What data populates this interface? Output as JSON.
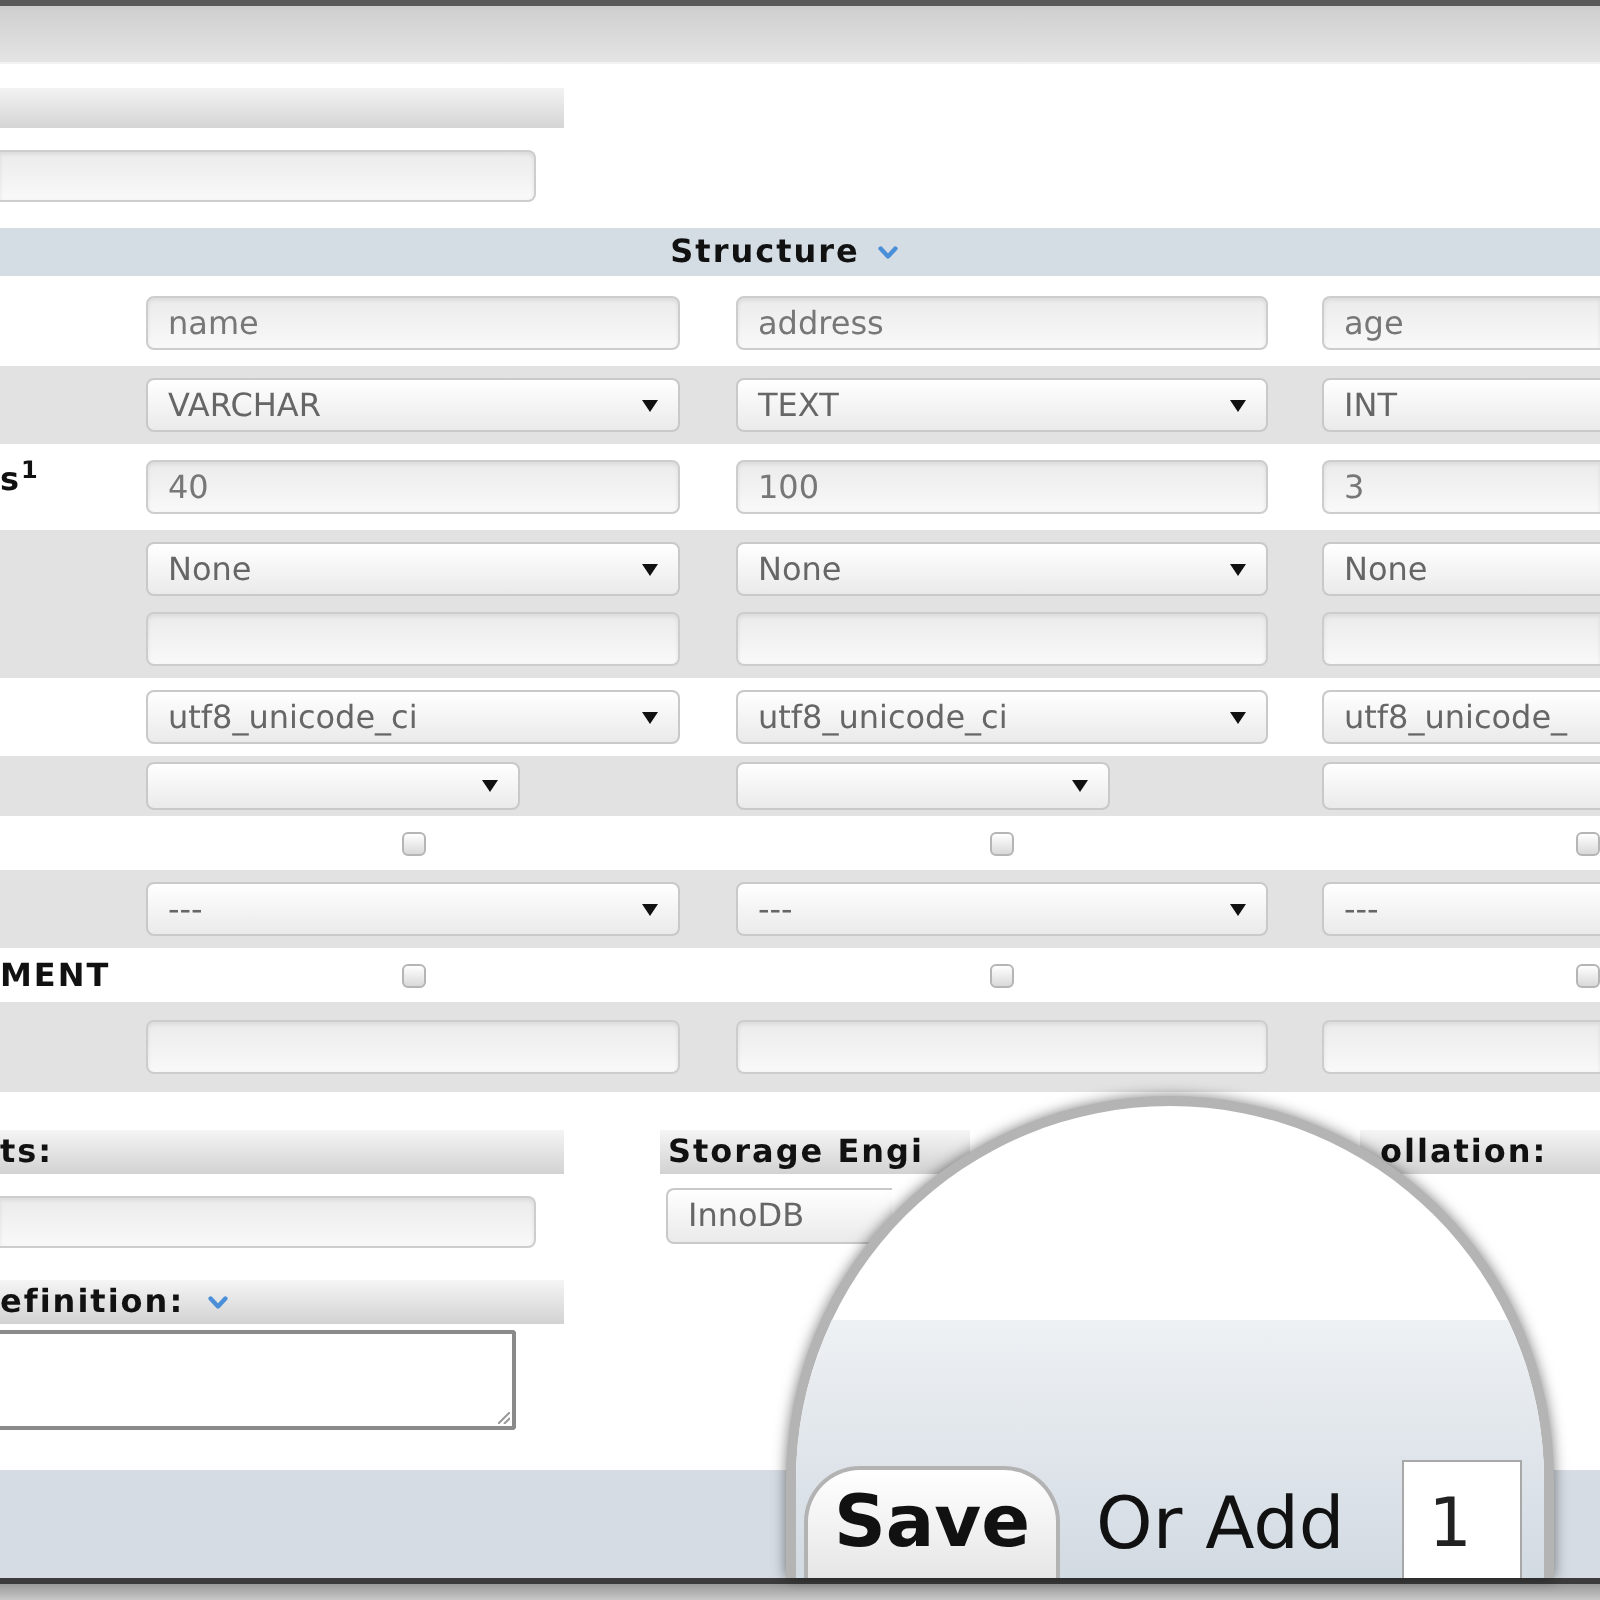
{
  "structure": {
    "title": "Structure",
    "collapsible": true,
    "rows": [
      {
        "cells": [
          {
            "kind": "input",
            "value": "name"
          },
          {
            "kind": "input",
            "value": "address"
          },
          {
            "kind": "input",
            "value": "age"
          }
        ]
      },
      {
        "cells": [
          {
            "kind": "select",
            "value": "VARCHAR"
          },
          {
            "kind": "select",
            "value": "TEXT"
          },
          {
            "kind": "select",
            "value": "INT"
          }
        ]
      },
      {
        "label": "s$^{1}$",
        "cells": [
          {
            "kind": "input",
            "value": "40"
          },
          {
            "kind": "input",
            "value": "100"
          },
          {
            "kind": "input",
            "value": "3"
          }
        ]
      },
      {
        "cells": [
          {
            "kind": "select_input",
            "value": "None"
          },
          {
            "kind": "select_input",
            "value": "None"
          },
          {
            "kind": "select_input",
            "value": "None"
          }
        ]
      },
      {
        "cells": [
          {
            "kind": "select",
            "value": "utf8_unicode_ci"
          },
          {
            "kind": "select",
            "value": "utf8_unicode_ci"
          },
          {
            "kind": "select",
            "value": "utf8_unicode_"
          }
        ]
      },
      {
        "cells": [
          {
            "kind": "short_select"
          },
          {
            "kind": "short_select"
          },
          {
            "kind": "short_select"
          }
        ]
      },
      {
        "cells": [
          {
            "kind": "checkbox",
            "checked": false
          },
          {
            "kind": "checkbox",
            "checked": false
          },
          {
            "kind": "checkbox",
            "checked": false
          }
        ]
      },
      {
        "cells": [
          {
            "kind": "select",
            "value": "---"
          },
          {
            "kind": "select",
            "value": "---"
          },
          {
            "kind": "select",
            "value": "---"
          }
        ]
      },
      {
        "label": "MENT",
        "cells": [
          {
            "kind": "checkbox",
            "checked": false
          },
          {
            "kind": "checkbox",
            "checked": false
          },
          {
            "kind": "checkbox",
            "checked": false
          }
        ]
      },
      {
        "cells": [
          {
            "kind": "input"
          },
          {
            "kind": "input"
          },
          {
            "kind": "input"
          }
        ]
      }
    ]
  },
  "options": {
    "columns": [
      [
        {
          "header": "ts:",
          "kind": "input",
          "collapsible": false
        },
        {
          "header": "efinition:",
          "kind": "textarea",
          "collapsible": true
        }
      ],
      [
        {
          "header": "Storage Engi",
          "kind": "select",
          "value": "InnoDB",
          "collapsible": false
        }
      ],
      [
        {
          "header": "ollation:",
          "kind": "header_only",
          "collapsible": false
        }
      ]
    ]
  },
  "magnifier": {
    "button": "Save",
    "label": "Or Add",
    "input_value": "1"
  }
}
